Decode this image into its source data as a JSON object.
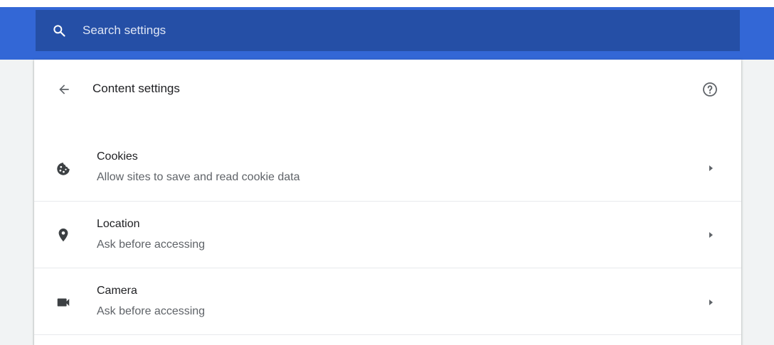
{
  "search": {
    "placeholder": "Search settings",
    "icon": "search-icon"
  },
  "header": {
    "title": "Content settings",
    "back_icon": "arrow-back-icon",
    "help_icon": "help-icon"
  },
  "items": [
    {
      "title": "Cookies",
      "subtitle": "Allow sites to save and read cookie data",
      "icon": "cookie-icon"
    },
    {
      "title": "Location",
      "subtitle": "Ask before accessing",
      "icon": "location-pin-icon"
    },
    {
      "title": "Camera",
      "subtitle": "Ask before accessing",
      "icon": "videocam-icon"
    }
  ],
  "colors": {
    "header_bar": "#3367d6",
    "search_box": "#254fa6",
    "background": "#f1f3f4"
  }
}
